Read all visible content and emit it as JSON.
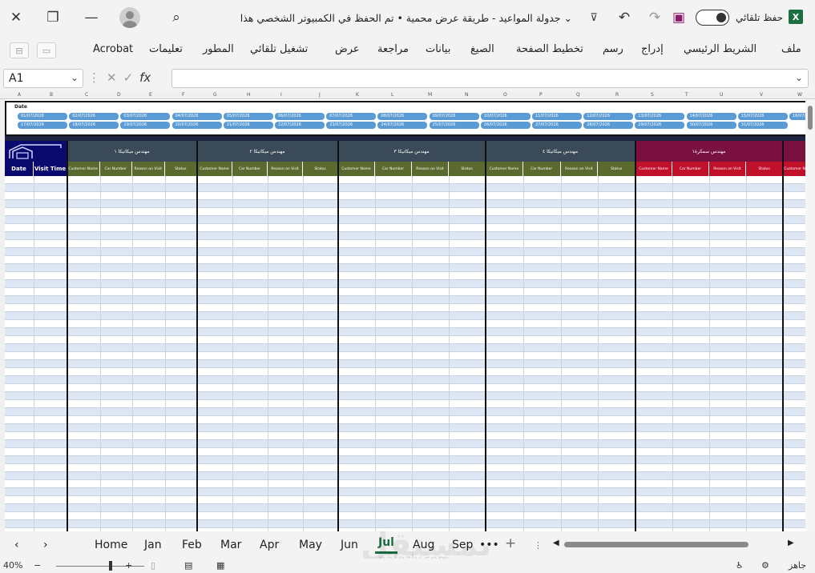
{
  "title": {
    "doc_name": "جدولة المواعيد  -  طريقة عرض محمية • تم الحفظ في الكمبيوتر الشخصي هذا",
    "autosave_label": "حفظ تلقائي"
  },
  "ribbon": {
    "tabs": [
      "ملف",
      "الشريط الرئيسي",
      "إدراج",
      "رسم",
      "تخطيط الصفحة",
      "الصيغ",
      "بيانات",
      "مراجعة",
      "عرض",
      "تشغيل تلقائي",
      "المطور",
      "تعليمات",
      "Acrobat"
    ]
  },
  "formula_bar": {
    "name_box": "A1",
    "fx": "fx"
  },
  "columns": [
    "A",
    "B",
    "C",
    "D",
    "E",
    "F",
    "G",
    "H",
    "I",
    "J",
    "K",
    "L",
    "M",
    "N",
    "O",
    "P",
    "Q",
    "R",
    "S",
    "T",
    "U",
    "V",
    "W"
  ],
  "date_panel": {
    "label": "Date",
    "row1": [
      "01/07/2026",
      "02/07/2026",
      "03/07/2026",
      "04/07/2026",
      "05/07/2026",
      "06/07/2026",
      "07/07/2026",
      "08/07/2026",
      "09/07/2026",
      "10/07/2026",
      "11/07/2026",
      "12/07/2026",
      "13/07/2026",
      "14/07/2026",
      "15/07/2026",
      "16/07/2026"
    ],
    "row2": [
      "17/07/2026",
      "18/07/2026",
      "19/07/2026",
      "20/07/2026",
      "21/07/2026",
      "22/07/2026",
      "23/07/2026",
      "24/07/2026",
      "25/07/2026",
      "26/07/2026",
      "27/07/2026",
      "28/07/2026",
      "29/07/2026",
      "30/07/2026",
      "31/07/2026"
    ]
  },
  "headers": {
    "date": "Date",
    "visit_time": "Visit Time",
    "engineers": [
      "مهندس ميكانيكا ١",
      "مهندس ميكانيكا ٢",
      "مهندس ميكانيكا ٣",
      "مهندس ميكانيكا ٤",
      "مهندس سمكرة١"
    ],
    "sub": [
      "Customer Name",
      "Car Number",
      "Reason on Visit",
      "Status"
    ]
  },
  "colors": {
    "navy": "#0a0a6e",
    "slate": "#3b4a58",
    "olive": "#5a6a2e",
    "maroon": "#7a1040",
    "red": "#c0102a",
    "chip": "#5b9bd5"
  },
  "sheet_tabs": [
    "Home",
    "Jan",
    "Feb",
    "Mar",
    "Apr",
    "May",
    "Jun",
    "Jul",
    "Aug",
    "Sep"
  ],
  "active_tab": "Jul",
  "status": {
    "ready": "جاهز",
    "zoom": "40%"
  },
  "watermark": {
    "main": "بمستقل",
    "url": "nafezly.com"
  }
}
